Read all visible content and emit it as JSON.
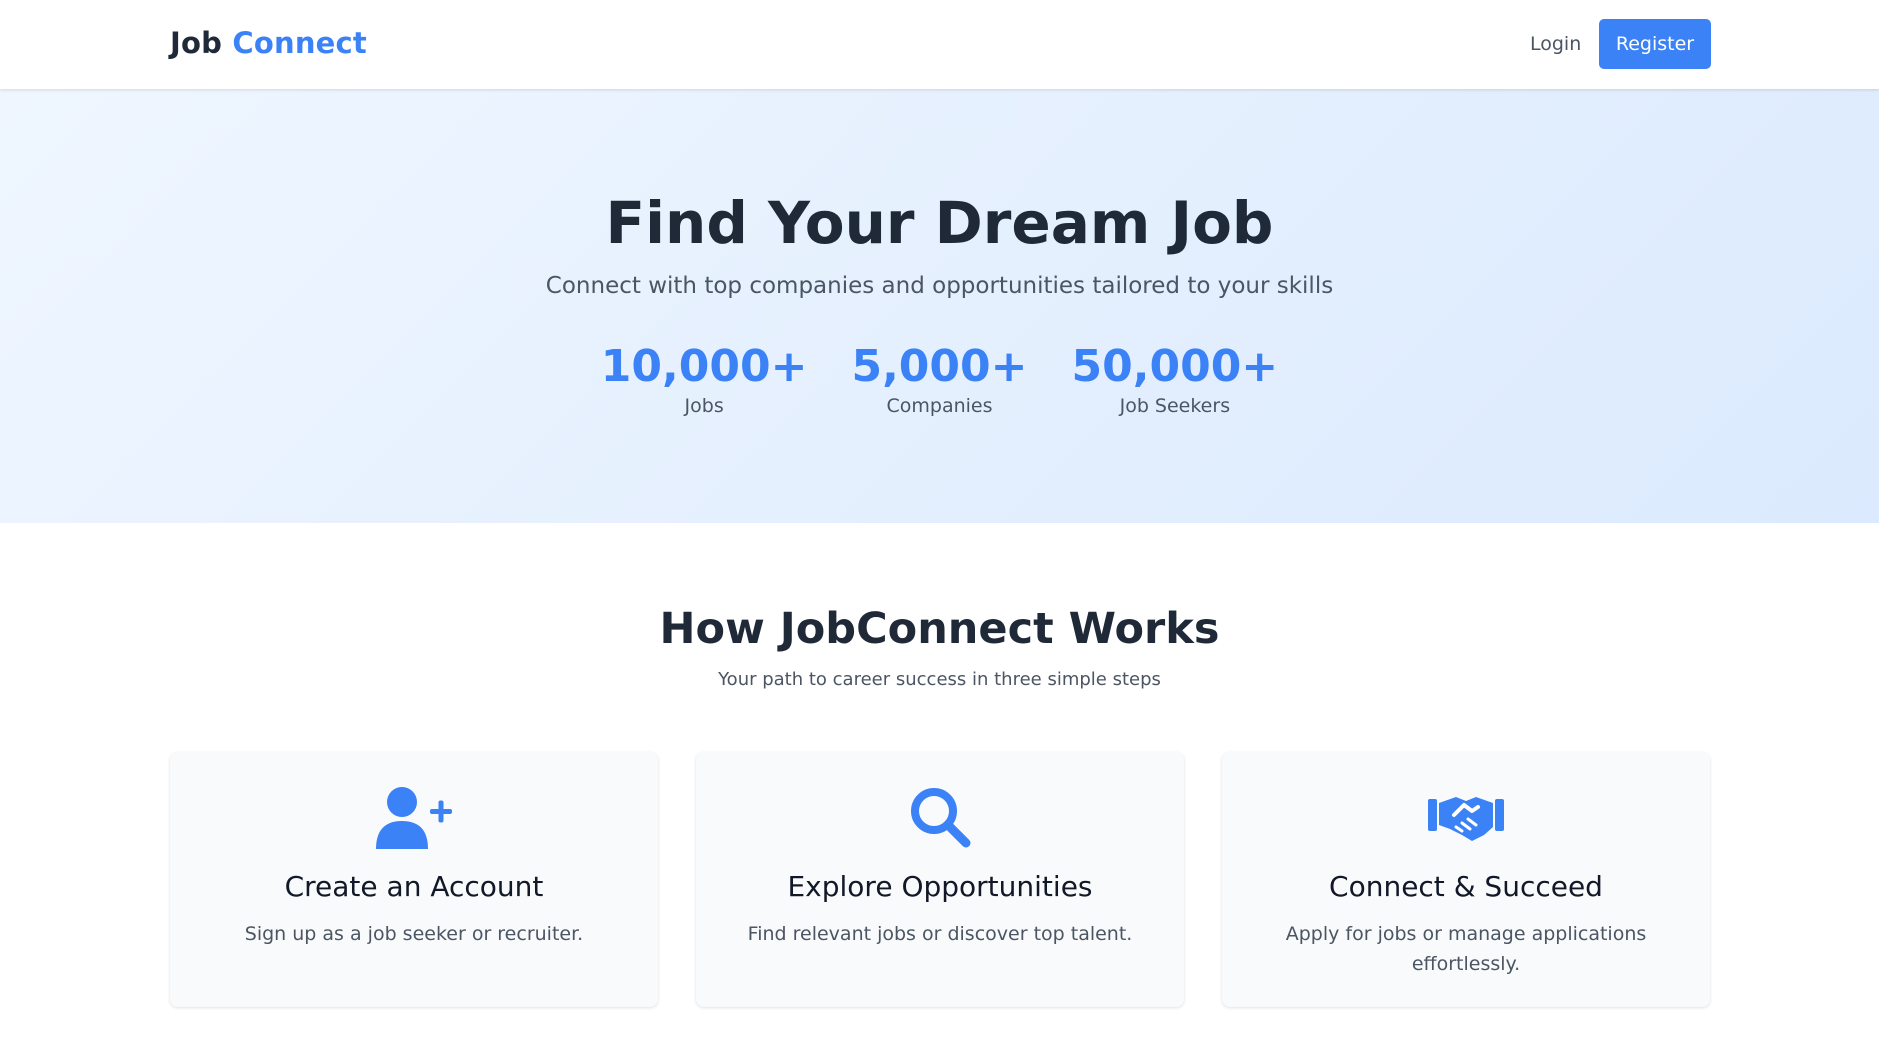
{
  "nav": {
    "brand_part1": "Job",
    "brand_part2": "Connect",
    "login_label": "Login",
    "register_label": "Register"
  },
  "hero": {
    "title": "Find Your Dream Job",
    "subtitle": "Connect with top companies and opportunities tailored to your skills",
    "stats": [
      {
        "value": "10,000+",
        "label": "Jobs"
      },
      {
        "value": "5,000+",
        "label": "Companies"
      },
      {
        "value": "50,000+",
        "label": "Job Seekers"
      }
    ]
  },
  "how": {
    "title": "How JobConnect Works",
    "subtitle": "Your path to career success in three simple steps",
    "cards": [
      {
        "icon": "user-plus-icon",
        "title": "Create an Account",
        "text": "Sign up as a job seeker or recruiter."
      },
      {
        "icon": "search-icon",
        "title": "Explore Opportunities",
        "text": "Find relevant jobs or discover top talent."
      },
      {
        "icon": "handshake-icon",
        "title": "Connect & Succeed",
        "text": "Apply for jobs or manage applications effortlessly."
      }
    ]
  },
  "colors": {
    "accent": "#3b82f6",
    "text_dark": "#1f2937",
    "text_muted": "#4b5563",
    "hero_bg_start": "#eff6ff",
    "hero_bg_end": "#dbeafe"
  }
}
